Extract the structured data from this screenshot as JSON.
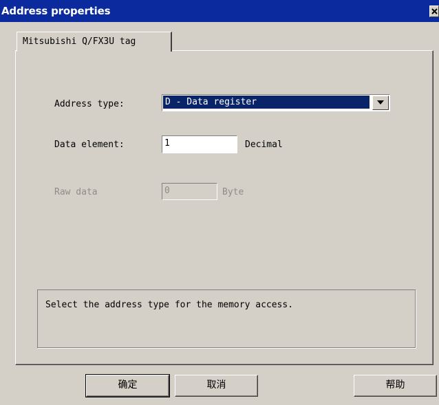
{
  "window": {
    "title": "Address properties",
    "close_icon": "close-icon"
  },
  "tabs": [
    {
      "label": "Mitsubishi Q/FX3U tag",
      "selected": true
    }
  ],
  "form": {
    "address_type": {
      "label": "Address type:",
      "value": "D - Data register",
      "dropdown_icon": "chevron-down-icon"
    },
    "data_element": {
      "label": "Data element:",
      "value": "1",
      "unit": "Decimal"
    },
    "raw_data": {
      "label": "Raw data",
      "value": "0",
      "unit": "Byte",
      "disabled": true
    }
  },
  "description": "Select the address type for the memory access.",
  "buttons": {
    "ok": "确定",
    "cancel": "取消",
    "help": "帮助"
  },
  "colors": {
    "titlebar": "#0a2a9e",
    "face": "#d4d0c8",
    "selection": "#0a246a",
    "disabled_text": "#8f8d88"
  }
}
